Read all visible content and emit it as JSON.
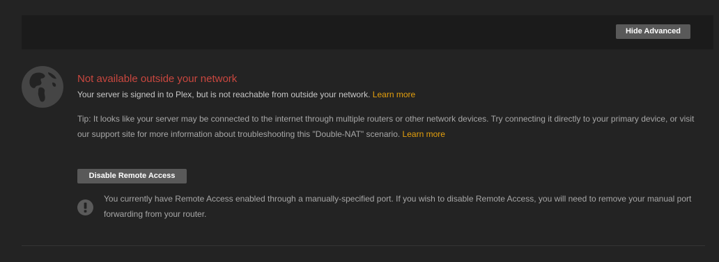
{
  "header": {
    "hide_advanced_label": "Hide Advanced"
  },
  "status": {
    "icon": "globe-icon",
    "title": "Not available outside your network",
    "title_color": "#c9473f",
    "description": "Your server is signed in to Plex, but is not reachable from outside your network.",
    "description_link": "Learn more"
  },
  "tip": {
    "text": "Tip: It looks like your server may be connected to the internet through multiple routers or other network devices. Try connecting it directly to your primary device, or visit our support site for more information about troubleshooting this \"Double-NAT\" scenario.",
    "link": "Learn more"
  },
  "remote_access": {
    "disable_label": "Disable Remote Access",
    "warning_icon": "exclamation-icon",
    "warning_text": "You currently have Remote Access enabled through a manually-specified port. If you wish to disable Remote Access, you will need to remove your manual port forwarding from your router."
  },
  "colors": {
    "background": "#232323",
    "header_bar": "#1b1b1b",
    "button": "#595959",
    "link": "#e5a00d"
  }
}
